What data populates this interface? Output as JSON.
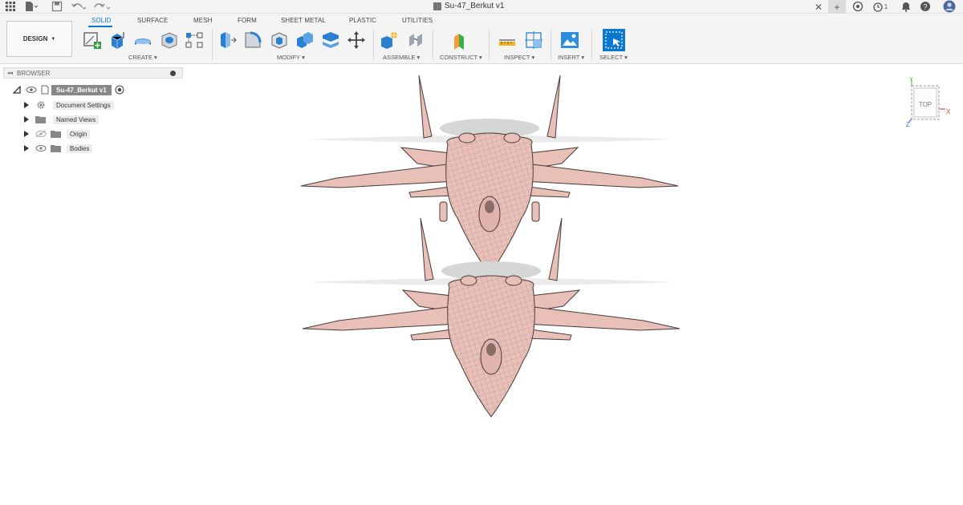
{
  "titlebar": {
    "document_title": "Su-47_Berkut v1",
    "job_count": "1",
    "icons": [
      "grid-icon",
      "file-menu-icon",
      "save-icon",
      "undo-icon",
      "redo-icon",
      "close-tab-icon",
      "new-tab-icon",
      "extensions-icon",
      "job-status-icon",
      "notifications-icon",
      "help-icon",
      "account-avatar"
    ]
  },
  "ribbon": {
    "workspace": "DESIGN",
    "tabs": [
      "SOLID",
      "SURFACE",
      "MESH",
      "FORM",
      "SHEET METAL",
      "PLASTIC",
      "UTILITIES"
    ],
    "active_tab": "SOLID",
    "groups": [
      "CREATE",
      "MODIFY",
      "ASSEMBLE",
      "CONSTRUCT",
      "INSPECT",
      "INSERT",
      "SELECT"
    ]
  },
  "browser": {
    "title": "BROWSER",
    "root": "Su-47_Berkut v1",
    "items": [
      "Document Settings",
      "Named Views",
      "Origin",
      "Bodies"
    ]
  },
  "viewcube": {
    "face": "TOP",
    "axis_y": "Y",
    "axis_x": "X",
    "axis_z": "Z"
  },
  "colors": {
    "accent": "#0a78d0",
    "model_fill": "#e8c0b8",
    "model_line": "#4a3a38"
  }
}
